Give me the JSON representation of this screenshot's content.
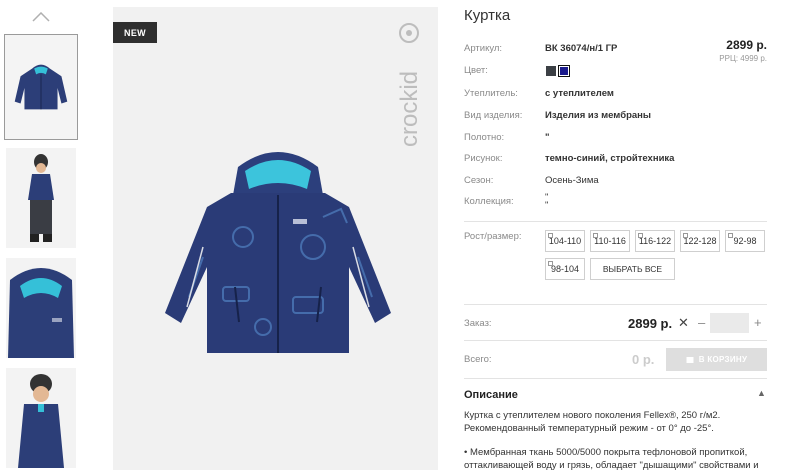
{
  "badge": "NEW",
  "brand": "crockid",
  "product": {
    "title": "Куртка",
    "price": "2899 р.",
    "rrc": "РРЦ: 4999 р.",
    "rows": [
      {
        "label": "Артикул:",
        "value": "ВК 36074/н/1 ГР"
      },
      {
        "label": "Цвет:",
        "value": ""
      },
      {
        "label": "Утеплитель:",
        "value": "с утеплителем"
      },
      {
        "label": "Вид изделия:",
        "value": "Изделия из мембраны"
      },
      {
        "label": "Полотно:",
        "value": "\""
      },
      {
        "label": "Рисунок:",
        "value": "темно-синий, стройтехника"
      },
      {
        "label": "Сезон:",
        "value": "Осень-Зима"
      },
      {
        "label": "Коллекция:",
        "value": "\"\n\""
      }
    ],
    "colors": [
      "#3c4045",
      "#1a1a8c"
    ],
    "sizes_label": "Рост/размер:",
    "sizes": [
      "104-110",
      "110-116",
      "116-122",
      "122-128",
      "92-98",
      "98-104"
    ],
    "select_all": "ВЫБРАТЬ ВСЕ"
  },
  "order": {
    "label": "Заказ:",
    "price": "2899 р.",
    "x": "✕",
    "minus": "–",
    "plus": "+",
    "qty": ""
  },
  "total": {
    "label": "Всего:",
    "value": "0 р.",
    "cart_button": "В КОРЗИНУ"
  },
  "description": {
    "title": "Описание",
    "toggle": "▲",
    "paragraph1_line1": "Куртка с утеплителем нового поколения Fellex®, 250 г/м2.",
    "paragraph1_line2": "Рекомендованный температурный режим - от 0° до -25°.",
    "paragraph2_line1": "• Мембранная ткань 5000/5000 покрыта тефлоновой пропиткой,",
    "paragraph2_line2": "оттакливающей воду и грязь, обладает \"дышащими\" свойствами и"
  }
}
